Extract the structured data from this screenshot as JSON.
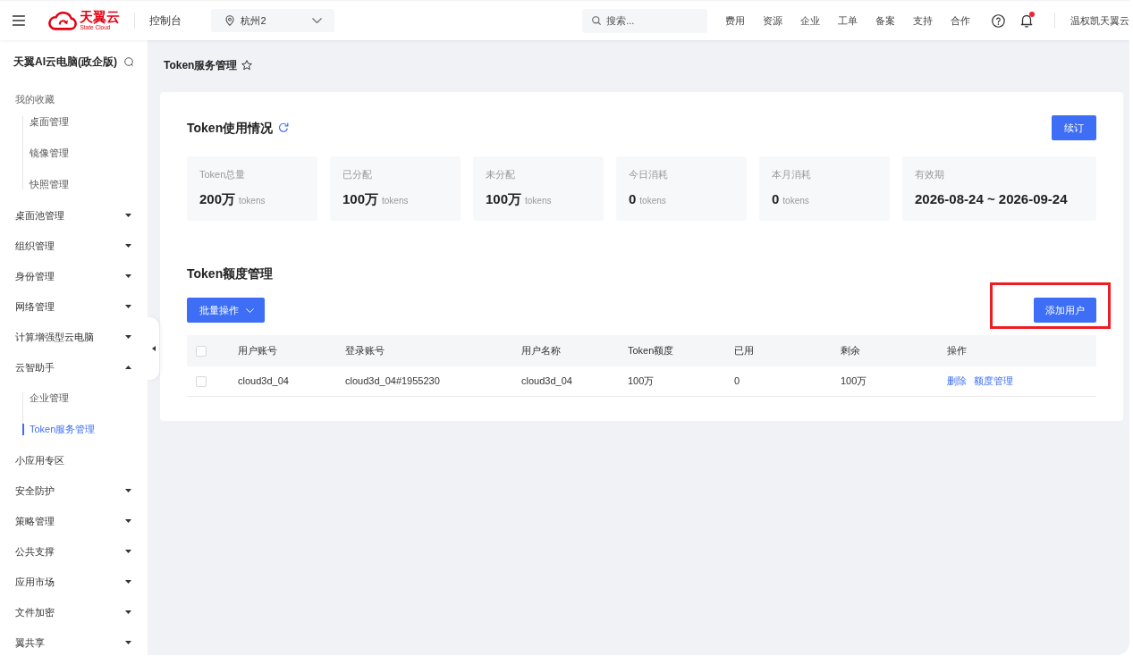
{
  "header": {
    "logo": {
      "name": "天翼云",
      "tagline": "State Cloud"
    },
    "console": "控制台",
    "region": {
      "value": "杭州2"
    },
    "search": {
      "placeholder": "搜索..."
    },
    "nav": [
      "费用",
      "资源",
      "企业",
      "工单",
      "备案",
      "支持",
      "合作"
    ],
    "notifications": {
      "unread": true
    },
    "user": "温权凯天翼云"
  },
  "sidebar": {
    "title": "天翼AI云电脑(政企版)",
    "items": [
      {
        "label": "我的收藏",
        "kind": "heading",
        "selected": false,
        "children": [
          {
            "label": "桌面管理",
            "selected": false
          },
          {
            "label": "镜像管理",
            "selected": false
          },
          {
            "label": "快照管理",
            "selected": false
          }
        ]
      },
      {
        "label": "桌面池管理",
        "kind": "group",
        "expanded": false,
        "selected": false
      },
      {
        "label": "组织管理",
        "kind": "group",
        "expanded": false,
        "selected": false
      },
      {
        "label": "身份管理",
        "kind": "group",
        "expanded": false,
        "selected": false
      },
      {
        "label": "网络管理",
        "kind": "group",
        "expanded": false,
        "selected": false
      },
      {
        "label": "计算增强型云电脑",
        "kind": "group",
        "expanded": false,
        "selected": false
      },
      {
        "label": "云智助手",
        "kind": "group",
        "expanded": true,
        "selected": false,
        "children": [
          {
            "label": "企业管理",
            "selected": false
          },
          {
            "label": "Token服务管理",
            "selected": true
          }
        ]
      },
      {
        "label": "小应用专区",
        "kind": "link",
        "selected": false
      },
      {
        "label": "安全防护",
        "kind": "group",
        "expanded": false,
        "selected": false
      },
      {
        "label": "策略管理",
        "kind": "group",
        "expanded": false,
        "selected": false
      },
      {
        "label": "公共支撑",
        "kind": "group",
        "expanded": false,
        "selected": false
      },
      {
        "label": "应用市场",
        "kind": "group",
        "expanded": false,
        "selected": false
      },
      {
        "label": "文件加密",
        "kind": "group",
        "expanded": false,
        "selected": false
      },
      {
        "label": "翼共享",
        "kind": "group",
        "expanded": false,
        "selected": false
      }
    ]
  },
  "breadcrumb": {
    "title": "Token服务管理",
    "favorited": false
  },
  "usage": {
    "title": "Token使用情况",
    "renew_button": "续订",
    "stats": [
      {
        "label": "Token总量",
        "value": "200万",
        "unit": "tokens"
      },
      {
        "label": "已分配",
        "value": "100万",
        "unit": "tokens"
      },
      {
        "label": "未分配",
        "value": "100万",
        "unit": "tokens"
      },
      {
        "label": "今日消耗",
        "value": "0",
        "unit": "tokens"
      },
      {
        "label": "本月消耗",
        "value": "0",
        "unit": "tokens"
      },
      {
        "label": "有效期",
        "value": "2026-08-24 ~ 2026-09-24"
      }
    ]
  },
  "quota": {
    "title": "Token额度管理",
    "bulk_button": "批量操作",
    "add_button": {
      "label": "添加用户",
      "highlighted": true
    },
    "table": {
      "all_checked": false,
      "columns": [
        "用户账号",
        "登录账号",
        "用户名称",
        "Token额度",
        "已用",
        "剩余",
        "操作"
      ],
      "rows": [
        {
          "checked": false,
          "cells": [
            "cloud3d_04",
            "cloud3d_04#1955230",
            "cloud3d_04",
            "100万",
            "0",
            "100万"
          ],
          "actions": [
            "删除",
            "额度管理"
          ]
        }
      ]
    }
  }
}
